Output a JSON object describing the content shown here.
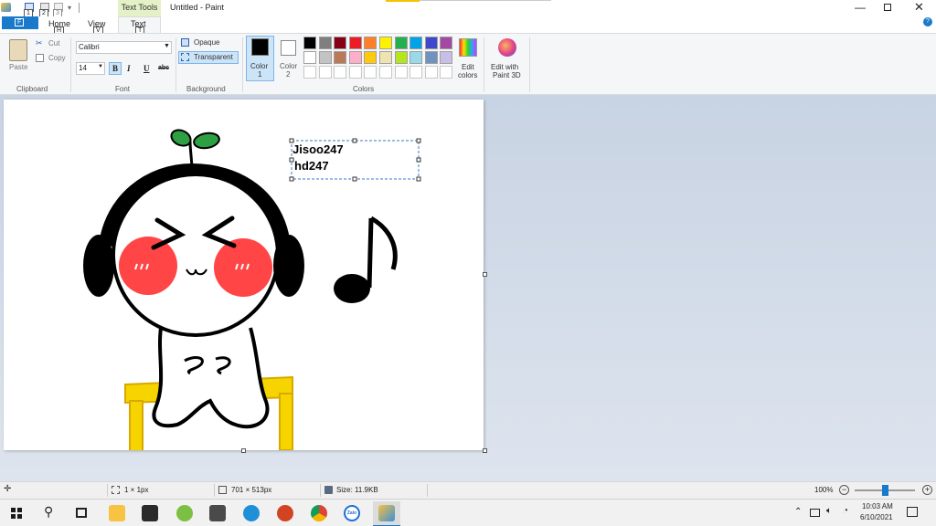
{
  "title_bar": {
    "quick_keys": [
      "1",
      "2",
      "3"
    ],
    "file_key": "F",
    "context_tab": "Text Tools",
    "window_title": "Untitled - Paint"
  },
  "tabs": {
    "home": "Home",
    "home_key": "H",
    "view": "View",
    "view_key": "V",
    "text": "Text",
    "text_key": "T"
  },
  "clipboard": {
    "paste": "Paste",
    "cut": "Cut",
    "copy": "Copy",
    "label": "Clipboard"
  },
  "font": {
    "family": "Calibri",
    "size": "14",
    "bold": "B",
    "italic": "I",
    "underline": "U",
    "strike": "abc",
    "label": "Font"
  },
  "background": {
    "opaque": "Opaque",
    "transparent": "Transparent",
    "label": "Background"
  },
  "colors": {
    "color1": "Color 1",
    "color1_l1": "Color",
    "color1_l2": "1",
    "color2_l1": "Color",
    "color2_l2": "2",
    "edit_l1": "Edit",
    "edit_l2": "colors",
    "p3d_l1": "Edit with",
    "p3d_l2": "Paint 3D",
    "label": "Colors",
    "row1": [
      "#000000",
      "#7f7f7f",
      "#880015",
      "#ed1c24",
      "#ff7f27",
      "#fff200",
      "#22b14c",
      "#00a2e8",
      "#3f48cc",
      "#a349a4"
    ],
    "row2": [
      "#ffffff",
      "#c3c3c3",
      "#b97a57",
      "#ffaec9",
      "#ffc90e",
      "#efe4b0",
      "#b5e61d",
      "#99d9ea",
      "#7092be",
      "#c8bfe7"
    ],
    "row3": [
      "#ffffff",
      "#ffffff",
      "#ffffff",
      "#ffffff",
      "#ffffff",
      "#ffffff",
      "#ffffff",
      "#ffffff",
      "#ffffff",
      "#ffffff"
    ]
  },
  "canvas_text": {
    "line1": "Jisoo247",
    "line2": "hd247"
  },
  "status": {
    "selection": "1 × 1px",
    "canvas_size": "701 × 513px",
    "file_size": "Size: 11.9KB",
    "zoom": "100%",
    "zoom_level": 0.5
  },
  "taskbar": {
    "time": "10:03 AM",
    "date": "6/10/2021",
    "zalo": "Zalo"
  },
  "help": {
    "badge": "?"
  }
}
